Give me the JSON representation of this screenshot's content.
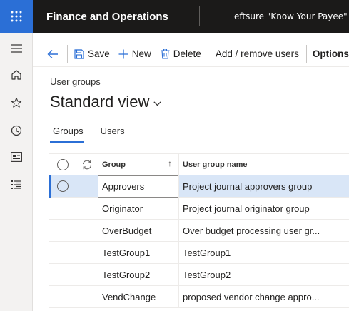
{
  "topbar": {
    "app_title": "Finance and Operations",
    "company": "eftsure \"Know Your Payee\""
  },
  "actionpane": {
    "save": "Save",
    "new": "New",
    "delete": "Delete",
    "add_remove_users": "Add / remove users",
    "options": "Options"
  },
  "page": {
    "caption": "User groups",
    "view_title": "Standard view"
  },
  "tabs": [
    {
      "label": "Groups",
      "active": true
    },
    {
      "label": "Users",
      "active": false
    }
  ],
  "grid": {
    "headers": {
      "group": "Group",
      "name": "User group name"
    },
    "rows": [
      {
        "group": "Approvers",
        "name": "Project journal approvers group"
      },
      {
        "group": "Originator",
        "name": "Project journal originator group"
      },
      {
        "group": "OverBudget",
        "name": "Over budget processing user gr..."
      },
      {
        "group": "TestGroup1",
        "name": "TestGroup1"
      },
      {
        "group": "TestGroup2",
        "name": "TestGroup2"
      },
      {
        "group": "VendChange",
        "name": "proposed vendor change appro..."
      }
    ]
  },
  "colors": {
    "accent": "#2b6fd6",
    "topbar": "#1b1a19",
    "selected_row": "#d9e6f7"
  }
}
